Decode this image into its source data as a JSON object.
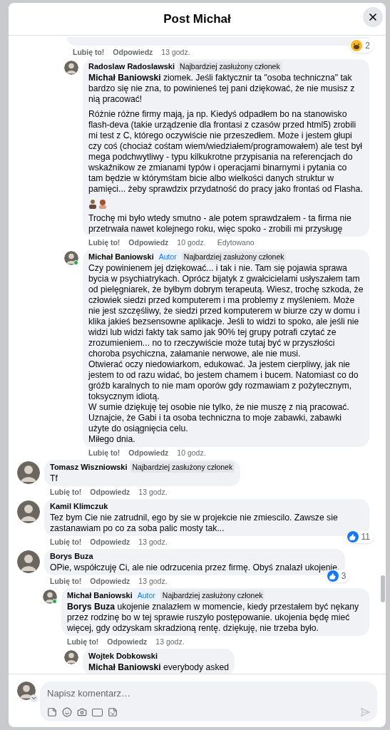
{
  "title": "Post Michał",
  "thread_top": {
    "actions": {
      "like": "Lubię to!",
      "reply": "Odpowiedz",
      "time": "13 godz."
    },
    "reaction": {
      "kind": "haha",
      "count": "2"
    },
    "replies": [
      {
        "author": "Radoslaw Radoslawski",
        "badges": [
          {
            "kind": "member",
            "label": "Najbardziej zasłużony członek"
          }
        ],
        "paragraphs": [
          {
            "kind": "text",
            "text": "**Michał Baniowski** ziomek. Jeśli faktycznir ta \"osoba techniczna\" tak bardzo się nie zna, to powinieneś tej pani dziękować, że nie musisz z nią pracować!"
          },
          {
            "kind": "text",
            "text": "Różnie różne firmy mają, ja np. Kiedyś odpadłem bo na stanowisko flash-deva (takie urządzenie dla frontasi z czasów przed html5) zrobili mi test z C, którego oczywiście nie przeszedłem. Może i jestem głupi czy coś (chociaż cośtam wiem/wiedziałem/programowałem) ale test był mega podchwytliwy - typu kilkukrotne przypisania na referencjach do wskaźnikow ze zmianami typów i operacjami binarnymi i pytania co tam będzie w którymśtam bicie albo wielkości danych struktur w pamięci... żeby sprawdzix przydatność do pracy jako frontaś od Flasha."
          },
          {
            "kind": "emoji"
          },
          {
            "kind": "text",
            "text": "Trochę mi było wtedy smutno - ale potem sprawdzałem - ta firma nie przetrwała nawet kolejnego roku, więc spoko - zrobili mi przysługę"
          }
        ],
        "actions": {
          "like": "Lubię to!",
          "reply": "Odpowiedz",
          "time": "10 godz.",
          "edited": "Edytowano"
        }
      },
      {
        "author": "Michał Baniowski",
        "online": true,
        "badges": [
          {
            "kind": "author",
            "label": "Autor"
          },
          {
            "kind": "member",
            "label": "Najbardziej zasłużony członek"
          }
        ],
        "paragraphs": [
          {
            "kind": "lines",
            "lines": [
              "Czy powinienem jej dziękować... i tak i nie. Tam się pojawia sprawa bycia w psychiatrykach. Oprócz bijatyk z gwałcicielami usłyszałem tam od pielęgniarek, że byłbym dobrym terapeutą. Wiesz, trochę szkoda, że człowiek siedzi przed komputerem i ma problemy z myśleniem. Może nie jest szczęśliwy, że siedzi przed komputerem w biurze czy w domu i klika jakieś bezsensowne aplikacje. Jeśli to widzi to spoko, ale jeśli nie widzi lub widzi fakty tak samo jak 90% tej grupy potrafi czytać ze zrozumieniem... no to rzeczywiście może tutaj być w przyszłości choroba psychiczna, załamanie nerwowe, ale nie musi.",
              "Otwierać oczy niedowiarkom, edukować. Ja jestem cierpliwy, jak nie jestem to od razu widać, bo jestem chamem i bucem. Natomiast co do gróźb karalnych to nie mam oporów gdy rozmawiam z pożytecznym, toksycznym idiotą.",
              "W sumie dziękuję tej osobie nie tylko, że nie muszę z nią pracować. Uznajcie, że Gabi i ta osoba techniczna to moje zabawki, zabawki użyte do osiągnięcia celu.",
              "Miłego dnia."
            ]
          }
        ],
        "actions": {
          "like": "Lubię to!",
          "reply": "Odpowiedz",
          "time": "10 godz."
        }
      }
    ]
  },
  "comments": [
    {
      "author": "Tomasz Wiszniowski",
      "badges": [
        {
          "kind": "member",
          "label": "Najbardziej zasłużony członek"
        }
      ],
      "paragraphs": [
        {
          "kind": "text",
          "text": "Tf"
        }
      ],
      "actions": {
        "like": "Lubię to!",
        "reply": "Odpowiedz",
        "time": "13 godz."
      }
    },
    {
      "author": "Kamil Klimczuk",
      "paragraphs": [
        {
          "kind": "text",
          "text": "Tez bym Cie nie zatrudnil, ego by sie w projekcie nie zmiescilo. Zawsze sie zastanawiam po co za soba palic mosty tak..."
        }
      ],
      "actions": {
        "like": "Lubię to!",
        "reply": "Odpowiedz",
        "time": "13 godz."
      },
      "reaction": {
        "kind": "like",
        "count": "11"
      }
    },
    {
      "author": "Borys Buza",
      "paragraphs": [
        {
          "kind": "text",
          "text": "OPie, współczuję Ci, ale nie odrzucenia przez firmę. Obyś znalazł ukojenie."
        }
      ],
      "actions": {
        "like": "Lubię to!",
        "reply": "Odpowiedz",
        "time": "13 godz."
      },
      "reaction": {
        "kind": "like",
        "count": "3"
      },
      "replies": [
        {
          "author": "Michał Baniowski",
          "online": true,
          "badges": [
            {
              "kind": "author",
              "label": "Autor"
            },
            {
              "kind": "member",
              "label": "Najbardziej zasłużony członek"
            }
          ],
          "paragraphs": [
            {
              "kind": "text",
              "text": "**Borys Buza** ukojenie znalazłem w momencie, kiedy przestałem być nękany przez rodzinę bo w tej sprawie ruszyło postępowanie. ukojenia będę mieć więcej, gdy odzyskam skradzioną rentę. dziękuję, nie trzeba było."
            }
          ],
          "actions": {
            "like": "Lubię to!",
            "reply": "Odpowiedz",
            "time": "13 godz."
          },
          "replies": [
            {
              "author": "Wojtek Dobkowski",
              "paragraphs": [
                {
                  "kind": "text",
                  "text": "**Michał Baniowski** everybody asked"
                }
              ]
            }
          ]
        }
      ]
    }
  ],
  "composer": {
    "placeholder": "Napisz komentarz…"
  }
}
